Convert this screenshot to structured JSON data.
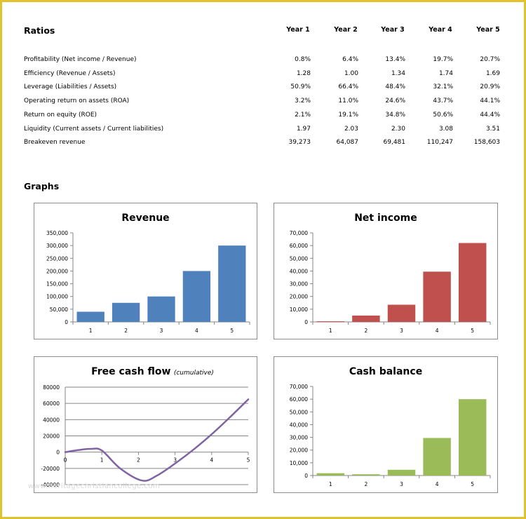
{
  "ratios": {
    "title": "Ratios",
    "years": [
      "Year 1",
      "Year 2",
      "Year 3",
      "Year 4",
      "Year 5"
    ],
    "rows": [
      {
        "label": "Profitability (Net income / Revenue)",
        "values": [
          "0.8%",
          "6.4%",
          "13.4%",
          "19.7%",
          "20.7%"
        ]
      },
      {
        "label": "Efficiency (Revenue  / Assets)",
        "values": [
          "1.28",
          "1.00",
          "1.34",
          "1.74",
          "1.69"
        ]
      },
      {
        "label": "Leverage (Liabilities / Assets)",
        "values": [
          "50.9%",
          "66.4%",
          "48.4%",
          "32.1%",
          "20.9%"
        ]
      },
      {
        "label": "Operating return on assets (ROA)",
        "values": [
          "3.2%",
          "11.0%",
          "24.6%",
          "43.7%",
          "44.1%"
        ]
      },
      {
        "label": "Return on equity (ROE)",
        "values": [
          "2.1%",
          "19.1%",
          "34.8%",
          "50.6%",
          "44.4%"
        ]
      },
      {
        "label": "Liquidity (Current assets / Current liabilities)",
        "values": [
          "1.97",
          "2.03",
          "2.30",
          "3.08",
          "3.51"
        ]
      },
      {
        "label": "Breakeven revenue",
        "values": [
          "39,273",
          "64,087",
          "69,481",
          "110,247",
          "158,603"
        ]
      }
    ]
  },
  "graphs": {
    "title": "Graphs"
  },
  "watermark": "www.heritagechristiancollege.com",
  "colors": {
    "border": "#e2c22c",
    "revenue": "#4f81bd",
    "net_income": "#c0504d",
    "cash_balance": "#9bbb59",
    "free_cash_flow": "#8064a2"
  },
  "chart_data": [
    {
      "type": "bar",
      "title": "Revenue",
      "categories": [
        "1",
        "2",
        "3",
        "4",
        "5"
      ],
      "values": [
        40000,
        75000,
        100000,
        200000,
        300000
      ],
      "ylim": [
        0,
        350000
      ],
      "yticks": [
        "0",
        "50,000",
        "100,000",
        "150,000",
        "200,000",
        "250,000",
        "300,000",
        "350,000"
      ],
      "ytick_values": [
        0,
        50000,
        100000,
        150000,
        200000,
        250000,
        300000,
        350000
      ],
      "xlabel": "",
      "ylabel": "",
      "grid": false,
      "color": "#4f81bd"
    },
    {
      "type": "bar",
      "title": "Net income",
      "categories": [
        "1",
        "2",
        "3",
        "4",
        "5"
      ],
      "values": [
        500,
        5000,
        13500,
        39500,
        62000
      ],
      "ylim": [
        0,
        70000
      ],
      "yticks": [
        "0",
        "10,000",
        "20,000",
        "30,000",
        "40,000",
        "50,000",
        "60,000",
        "70,000"
      ],
      "ytick_values": [
        0,
        10000,
        20000,
        30000,
        40000,
        50000,
        60000,
        70000
      ],
      "xlabel": "",
      "ylabel": "",
      "grid": false,
      "color": "#c0504d"
    },
    {
      "type": "line",
      "title": "Free cash flow",
      "subtitle": "(cumulative)",
      "x": [
        0,
        1,
        2,
        3,
        4,
        5
      ],
      "series": [
        {
          "name": "Free cash flow",
          "values": [
            0,
            2000,
            -34000,
            -14000,
            22000,
            65000
          ]
        }
      ],
      "smooth_points": [
        [
          0,
          0
        ],
        [
          0.35,
          2500
        ],
        [
          0.7,
          4000
        ],
        [
          1,
          2000
        ],
        [
          1.5,
          -20000
        ],
        [
          2.1,
          -35000
        ],
        [
          2.5,
          -29000
        ],
        [
          3,
          -14000
        ],
        [
          3.5,
          3000
        ],
        [
          4,
          22000
        ],
        [
          4.5,
          43000
        ],
        [
          5,
          65000
        ]
      ],
      "ylim": [
        -40000,
        80000
      ],
      "yticks": [
        "-40000",
        "-20000",
        "0",
        "20000",
        "40000",
        "60000",
        "80000"
      ],
      "ytick_values": [
        -40000,
        -20000,
        0,
        20000,
        40000,
        60000,
        80000
      ],
      "xticks": [
        "0",
        "1",
        "2",
        "3",
        "4",
        "5"
      ],
      "xlabel": "",
      "ylabel": "",
      "grid": true,
      "color": "#8064a2"
    },
    {
      "type": "bar",
      "title": "Cash balance",
      "categories": [
        "1",
        "2",
        "3",
        "4",
        "5"
      ],
      "values": [
        1800,
        1000,
        4500,
        29500,
        60000
      ],
      "ylim": [
        0,
        70000
      ],
      "yticks": [
        "0",
        "10,000",
        "20,000",
        "30,000",
        "40,000",
        "50,000",
        "60,000",
        "70,000"
      ],
      "ytick_values": [
        0,
        10000,
        20000,
        30000,
        40000,
        50000,
        60000,
        70000
      ],
      "xlabel": "",
      "ylabel": "",
      "grid": false,
      "color": "#9bbb59"
    }
  ]
}
